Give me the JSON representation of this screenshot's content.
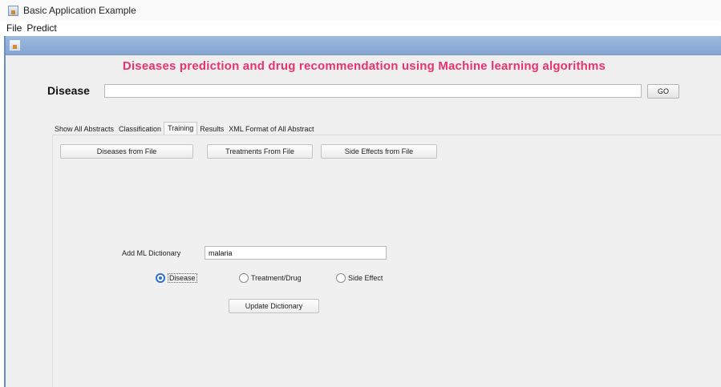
{
  "window": {
    "title": "Basic Application Example"
  },
  "menu": {
    "items": [
      "File",
      "Predict"
    ]
  },
  "headline": "Diseases prediction and drug recommendation using Machine learning algorithms",
  "search": {
    "label": "Disease",
    "value": "",
    "go_label": "GO"
  },
  "tabs": [
    {
      "label": "Show All Abstracts",
      "active": false
    },
    {
      "label": "Classification",
      "active": false
    },
    {
      "label": "Training",
      "active": true
    },
    {
      "label": "Results",
      "active": false
    },
    {
      "label": "XML Format of All Abstract",
      "active": false
    }
  ],
  "training": {
    "buttons": {
      "diseases_from_file": "Diseases from File",
      "treatments_from_file": "Treatments From File",
      "side_effects_from_file": "Side Effects from File"
    },
    "dictionary": {
      "label": "Add ML Dictionary",
      "value": "malaria"
    },
    "radios": [
      {
        "label": "Disease",
        "selected": true
      },
      {
        "label": "Treatment/Drug",
        "selected": false
      },
      {
        "label": "Side Effect",
        "selected": false
      }
    ],
    "update_label": "Update Dictionary"
  },
  "colors": {
    "headline": "#e8336c",
    "title_bar": "#9cb8dd",
    "radio_selected": "#2f6fce"
  },
  "icons": {
    "window": "java-app-icon"
  }
}
